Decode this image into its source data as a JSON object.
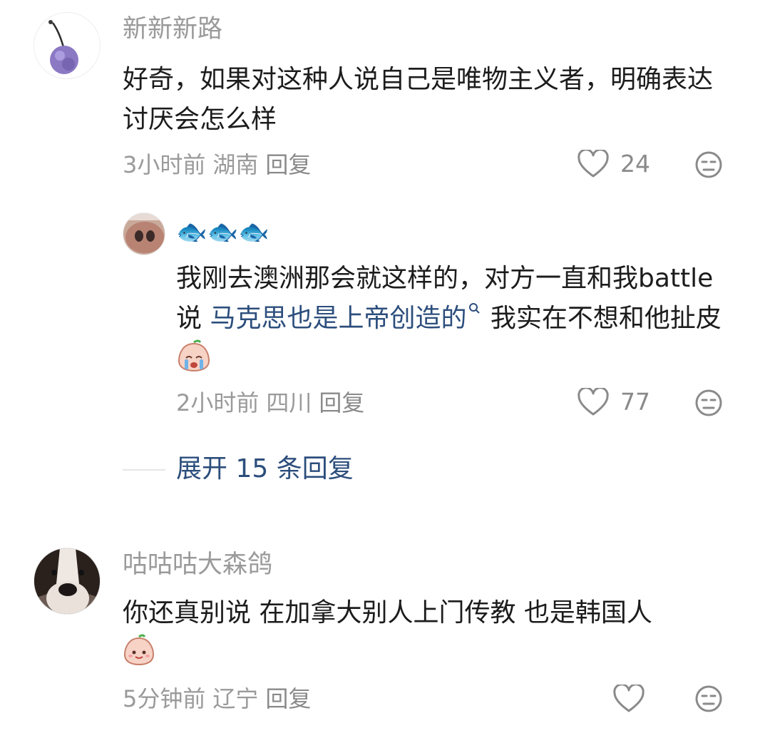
{
  "comments": [
    {
      "username": "新新新路",
      "text": "好奇，如果对这种人说自己是唯物主义者，明确表达讨厌会怎么样",
      "time": "3小时前",
      "location": "湖南",
      "reply_label": "回复",
      "likes": "24",
      "avatar_icon": "purple-cherry-avatar-icon"
    },
    {
      "username": "🐟🐟🐟",
      "text_before": "我刚去澳洲那会就这样的，对方一直和我battle说 ",
      "link_text": "马克思也是上帝创造的",
      "text_after": " 我实在不想和他扯皮",
      "time": "2小时前",
      "location": "四川",
      "reply_label": "回复",
      "likes": "77",
      "avatar_icon": "pig-nose-avatar-icon"
    },
    {
      "username": "咕咕咕大森鸽",
      "text": "你还真别说 在加拿大别人上门传教 也是韩国人",
      "time": "5分钟前",
      "location": "辽宁",
      "reply_label": "回复",
      "likes": "",
      "avatar_icon": "dog-avatar-icon"
    }
  ],
  "expand_replies": "展开 15 条回复",
  "colors": {
    "link": "#2c4e7c",
    "meta": "#9a9a9a"
  }
}
